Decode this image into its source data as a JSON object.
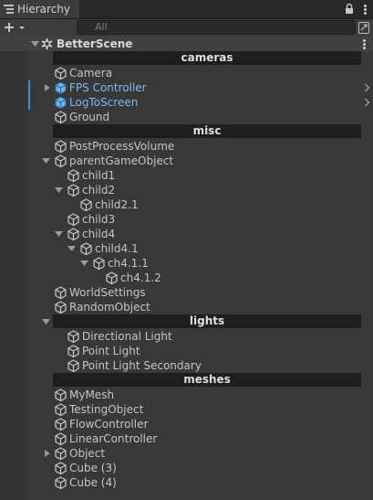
{
  "window": {
    "tab_title": "Hierarchy",
    "search_placeholder": "All"
  },
  "colors": {
    "prefab_text": "#7fb7f3",
    "separator_bg": "#1e1e1e",
    "prefab_indicator": "#3b8fd9"
  },
  "scene": {
    "name": "BetterScene"
  },
  "rows": [
    {
      "kind": "separator",
      "text": "cameras"
    },
    {
      "kind": "object",
      "text": "Camera",
      "depth": 0
    },
    {
      "kind": "object",
      "text": "FPS Controller",
      "depth": 0,
      "prefab": true,
      "foldout": "closed",
      "override_arrow": true
    },
    {
      "kind": "object",
      "text": "LogToScreen",
      "depth": 0,
      "prefab": true,
      "override_arrow": true
    },
    {
      "kind": "object",
      "text": "Ground",
      "depth": 0
    },
    {
      "kind": "separator",
      "text": "misc"
    },
    {
      "kind": "object",
      "text": "PostProcessVolume",
      "depth": 0
    },
    {
      "kind": "object",
      "text": "parentGameObject",
      "depth": 0,
      "foldout": "open"
    },
    {
      "kind": "object",
      "text": "child1",
      "depth": 1
    },
    {
      "kind": "object",
      "text": "child2",
      "depth": 1,
      "foldout": "open"
    },
    {
      "kind": "object",
      "text": "child2.1",
      "depth": 2
    },
    {
      "kind": "object",
      "text": "child3",
      "depth": 1
    },
    {
      "kind": "object",
      "text": "child4",
      "depth": 1,
      "foldout": "open"
    },
    {
      "kind": "object",
      "text": "child4.1",
      "depth": 2,
      "foldout": "open"
    },
    {
      "kind": "object",
      "text": "ch4.1.1",
      "depth": 3,
      "foldout": "open"
    },
    {
      "kind": "object",
      "text": "ch4.1.2",
      "depth": 4
    },
    {
      "kind": "object",
      "text": "WorldSettings",
      "depth": 0
    },
    {
      "kind": "object",
      "text": "RandomObject",
      "depth": 0
    },
    {
      "kind": "separator",
      "text": "lights",
      "foldout": "open"
    },
    {
      "kind": "object",
      "text": "Directional Light",
      "depth": 1
    },
    {
      "kind": "object",
      "text": "Point Light",
      "depth": 1
    },
    {
      "kind": "object",
      "text": "Point Light Secondary",
      "depth": 1
    },
    {
      "kind": "separator",
      "text": "meshes"
    },
    {
      "kind": "object",
      "text": "MyMesh",
      "depth": 0
    },
    {
      "kind": "object",
      "text": "TestingObject",
      "depth": 0
    },
    {
      "kind": "object",
      "text": "FlowController",
      "depth": 0
    },
    {
      "kind": "object",
      "text": "LinearController",
      "depth": 0
    },
    {
      "kind": "object",
      "text": "Object",
      "depth": 0,
      "foldout": "closed"
    },
    {
      "kind": "object",
      "text": "Cube (3)",
      "depth": 0
    },
    {
      "kind": "object",
      "text": "Cube (4)",
      "depth": 0
    }
  ]
}
